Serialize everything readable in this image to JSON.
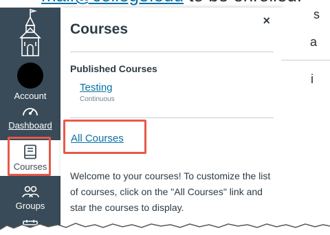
{
  "top_strip": {
    "link_text": "mail@college.edu",
    "rest_text": "to be enrolled."
  },
  "nav": {
    "items": [
      {
        "label": "Account"
      },
      {
        "label": "Dashboard"
      },
      {
        "label": "Courses"
      },
      {
        "label": "Groups"
      }
    ]
  },
  "tray": {
    "title": "Courses",
    "close_glyph": "×",
    "published_heading": "Published Courses",
    "course": {
      "name": "Testing",
      "term": "Continuous"
    },
    "all_courses_label": "All Courses",
    "welcome_text": "Welcome to your courses! To customize the list of courses, click on the \"All Courses\" link and star the courses to display."
  },
  "right_page": {
    "line1": "s",
    "line2": "a",
    "line3": "i"
  },
  "colors": {
    "nav_bg": "#394b58",
    "link": "#0770a3",
    "highlight": "#e8584a",
    "text": "#2d3b45"
  }
}
